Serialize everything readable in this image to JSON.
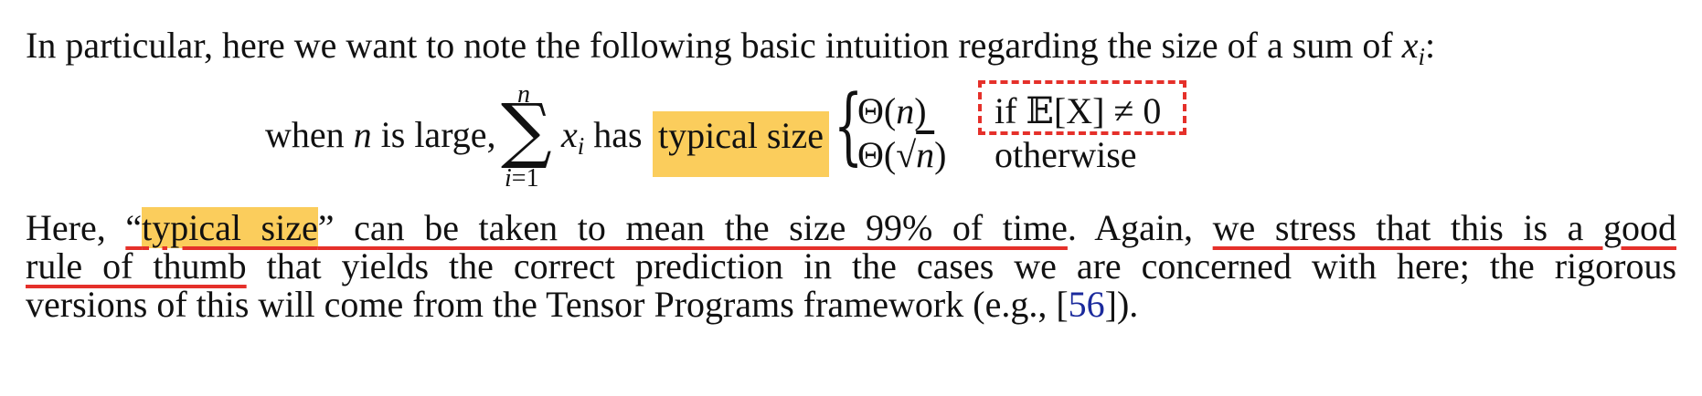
{
  "paragraph1": {
    "text_before": "In particular, here we want to note the following basic intuition regarding the size of a sum of ",
    "math_var": "x",
    "math_sub": "i",
    "text_after": ":"
  },
  "equation": {
    "prefix": "when",
    "n": "n",
    "is_large": "is large,",
    "sum_upper": "n",
    "sum_lower": "i=1",
    "sum_symbol": "∑",
    "term_var": "x",
    "term_sub": "i",
    "has": "has",
    "highlight": "typical size",
    "brace": "{",
    "case1_value": "Θ(n)",
    "case1_condition": "if 𝔼[X] ≠ 0",
    "case2_value": "Θ(√n)",
    "case2_condition": "otherwise"
  },
  "paragraph2": {
    "line1": {
      "here": "Here, ",
      "open_quote": "“",
      "highlight": "typical size",
      "close_quote_rest": "” can be taken to mean the size 99% of time",
      "period_again": ". Again, ",
      "underlined_tail": "we stress that this is a good"
    },
    "line2": {
      "underlined_head": "rule of thumb",
      "rest": " that yields the correct prediction in the cases we are concerned with here; the rigorous"
    },
    "line3": {
      "text_before": "versions of this will come from the Tensor Programs framework (e.g., [",
      "citation": "56",
      "text_after": "])."
    }
  },
  "colors": {
    "highlight": "#fbcd5c",
    "annotation_red": "#e5302a",
    "citation_blue": "#1b2a9c"
  }
}
